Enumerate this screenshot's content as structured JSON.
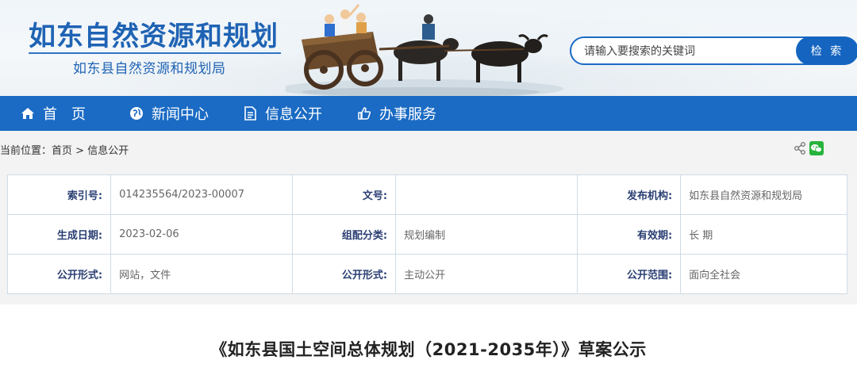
{
  "header": {
    "title": "如东自然资源和规划",
    "subtitle": "如东县自然资源和规划局"
  },
  "search": {
    "placeholder": "请输入要搜索的关键词",
    "button": "检 索"
  },
  "nav": {
    "items": [
      {
        "label": "首　页",
        "icon": "home-icon"
      },
      {
        "label": "新闻中心",
        "icon": "globe-icon"
      },
      {
        "label": "信息公开",
        "icon": "document-icon"
      },
      {
        "label": "办事服务",
        "icon": "thumbs-up-icon"
      }
    ]
  },
  "breadcrumb": {
    "prefix": "当前位置：",
    "home": "首页",
    "sep": " > ",
    "current": "信息公开"
  },
  "info_table": {
    "rows": [
      [
        {
          "label": "索引号:",
          "value": "014235564/2023-00007"
        },
        {
          "label": "文号:",
          "value": ""
        },
        {
          "label": "发布机构:",
          "value": "如东县自然资源和规划局"
        }
      ],
      [
        {
          "label": "生成日期:",
          "value": "2023-02-06"
        },
        {
          "label": "组配分类:",
          "value": "规划编制"
        },
        {
          "label": "有效期:",
          "value": "长 期"
        }
      ],
      [
        {
          "label": "公开形式:",
          "value": "网站，文件"
        },
        {
          "label": "公开形式:",
          "value": "主动公开"
        },
        {
          "label": "公开范围:",
          "value": "面向全社会"
        }
      ]
    ]
  },
  "document": {
    "title": "《如东县国土空间总体规划（2021-2035年）》草案公示"
  },
  "colors": {
    "brand_blue": "#1b6bc4",
    "title_blue": "#1f63b4",
    "label_navy": "#2a3f73",
    "wechat_green": "#28b33c"
  }
}
